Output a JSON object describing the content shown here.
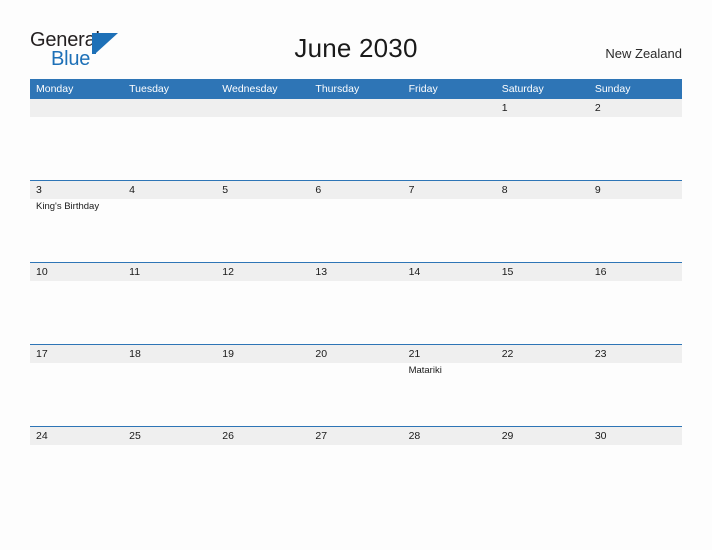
{
  "brand": {
    "name_part1": "General",
    "name_part2": "Blue",
    "accent_color": "#1d70b7"
  },
  "header": {
    "title": "June 2030",
    "country": "New Zealand"
  },
  "calendar": {
    "header_color": "#2e75b6",
    "daynum_band_color": "#efefef",
    "weekday_headers": [
      "Monday",
      "Tuesday",
      "Wednesday",
      "Thursday",
      "Friday",
      "Saturday",
      "Sunday"
    ],
    "weeks": [
      [
        {
          "day": "",
          "events": []
        },
        {
          "day": "",
          "events": []
        },
        {
          "day": "",
          "events": []
        },
        {
          "day": "",
          "events": []
        },
        {
          "day": "",
          "events": []
        },
        {
          "day": "1",
          "events": []
        },
        {
          "day": "2",
          "events": []
        }
      ],
      [
        {
          "day": "3",
          "events": [
            "King's Birthday"
          ]
        },
        {
          "day": "4",
          "events": []
        },
        {
          "day": "5",
          "events": []
        },
        {
          "day": "6",
          "events": []
        },
        {
          "day": "7",
          "events": []
        },
        {
          "day": "8",
          "events": []
        },
        {
          "day": "9",
          "events": []
        }
      ],
      [
        {
          "day": "10",
          "events": []
        },
        {
          "day": "11",
          "events": []
        },
        {
          "day": "12",
          "events": []
        },
        {
          "day": "13",
          "events": []
        },
        {
          "day": "14",
          "events": []
        },
        {
          "day": "15",
          "events": []
        },
        {
          "day": "16",
          "events": []
        }
      ],
      [
        {
          "day": "17",
          "events": []
        },
        {
          "day": "18",
          "events": []
        },
        {
          "day": "19",
          "events": []
        },
        {
          "day": "20",
          "events": []
        },
        {
          "day": "21",
          "events": [
            "Matariki"
          ]
        },
        {
          "day": "22",
          "events": []
        },
        {
          "day": "23",
          "events": []
        }
      ],
      [
        {
          "day": "24",
          "events": []
        },
        {
          "day": "25",
          "events": []
        },
        {
          "day": "26",
          "events": []
        },
        {
          "day": "27",
          "events": []
        },
        {
          "day": "28",
          "events": []
        },
        {
          "day": "29",
          "events": []
        },
        {
          "day": "30",
          "events": []
        }
      ]
    ]
  }
}
